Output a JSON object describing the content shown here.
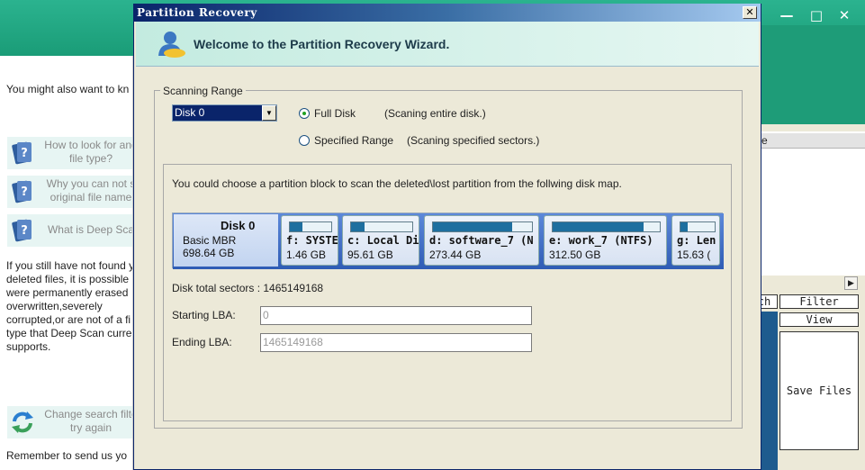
{
  "background_window": {
    "left_pane": {
      "intro": "You might also want to kn",
      "help_items": [
        {
          "line1": "How to look for and",
          "line2": "file type?"
        },
        {
          "line1": "Why you can not s",
          "line2": "original file name"
        },
        {
          "line1": "What is Deep Sca",
          "line2": ""
        }
      ],
      "paragraph": [
        "If you still have not found y",
        "deleted files, it is possible",
        "were permanently erased",
        "overwritten,severely",
        "corrupted,or are not of a fi",
        "type that Deep Scan curre",
        "supports."
      ],
      "change_search": {
        "line1": "Change search filte",
        "line2": "try again"
      },
      "footer": "Remember to send us yo"
    },
    "right_pane": {
      "column_header": "e",
      "buttons": {
        "search": "ch",
        "filter": "Filter",
        "view": "View",
        "save": "Save Files"
      }
    },
    "controls": {
      "minimize": "—",
      "maximize": "□",
      "close": "✕"
    }
  },
  "dialog": {
    "title": "Partition Recovery",
    "close": "✕",
    "header_title": "Welcome to the Partition Recovery Wizard.",
    "scanning_range": {
      "legend": "Scanning Range",
      "disk_select": {
        "value": "Disk 0"
      },
      "options": [
        {
          "label": "Full Disk",
          "description": "(Scaning entire disk.)",
          "checked": true
        },
        {
          "label": "Specified Range",
          "description": "(Scaning specified sectors.)",
          "checked": false
        }
      ]
    },
    "instructions": "You could choose a partition block to scan the deleted\\lost partition from the follwing disk map.",
    "disk_map": {
      "disk": {
        "name": "Disk 0",
        "type": "Basic MBR",
        "size": "698.64 GB"
      },
      "partitions": [
        {
          "name": "f: SYSTE",
          "size": "1.46 GB",
          "used_fraction": 0.3
        },
        {
          "name": "c: Local Dis",
          "size": "95.61 GB",
          "used_fraction": 0.22
        },
        {
          "name": "d: software_7 (N",
          "size": "273.44 GB",
          "used_fraction": 0.8
        },
        {
          "name": "e: work_7 (NTFS)",
          "size": "312.50 GB",
          "used_fraction": 0.85
        },
        {
          "name": "g: Len",
          "size": "15.63 (",
          "used_fraction": 0.2
        }
      ]
    },
    "total_sectors": "Disk total sectors : 1465149168",
    "starting_lba": {
      "label": "Starting LBA:",
      "value": "0"
    },
    "ending_lba": {
      "label": "Ending LBA:",
      "value": "1465149168"
    }
  }
}
